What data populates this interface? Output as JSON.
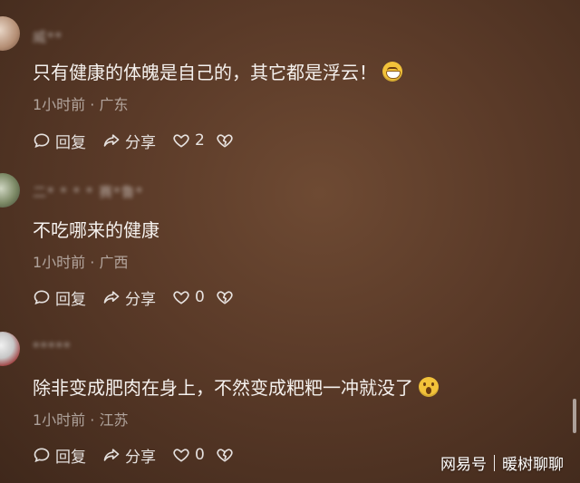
{
  "comments": [
    {
      "username": "威**",
      "text": "只有健康的体魄是自己的，其它都是浮云！",
      "emoji": "grinning-face",
      "time": "1小时前",
      "region": "广东",
      "reply_label": "回复",
      "share_label": "分享",
      "likes": "2"
    },
    {
      "username": "二* *  *  * 赛*鲁*",
      "text": "不吃哪来的健康",
      "emoji": "",
      "time": "1小时前",
      "region": "广西",
      "reply_label": "回复",
      "share_label": "分享",
      "likes": "0"
    },
    {
      "username": "*****",
      "text": "除非变成肥肉在身上，不然变成粑粑一冲就没了",
      "emoji": "fearful-face",
      "time": "1小时前",
      "region": "江苏",
      "reply_label": "回复",
      "share_label": "分享",
      "likes": "0"
    }
  ],
  "separator": "·",
  "watermark": {
    "source": "网易号",
    "author": "暖树聊聊"
  }
}
